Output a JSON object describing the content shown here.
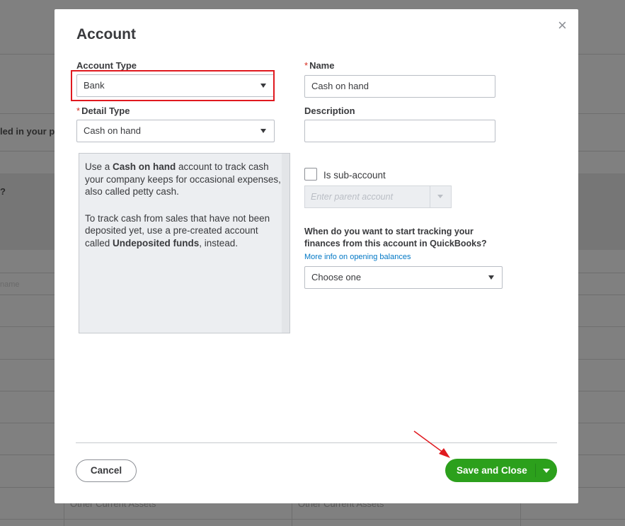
{
  "background": {
    "partial_text_1": "led in your p",
    "partial_text_2": "?",
    "partial_placeholder": "name",
    "row_cell_1": "Other Current Assets",
    "row_cell_2": "Other Current Assets"
  },
  "dialog": {
    "title": "Account",
    "close_glyph": "×",
    "account_type": {
      "label": "Account Type",
      "value": "Bank"
    },
    "detail_type": {
      "label": "Detail Type",
      "required_mark": "*",
      "value": "Cash on hand"
    },
    "name": {
      "label": "Name",
      "required_mark": "*",
      "value": "Cash on hand"
    },
    "description": {
      "label": "Description",
      "value": ""
    },
    "info": {
      "p1_pre": "Use a ",
      "p1_bold": "Cash on hand",
      "p1_post": " account to track cash your company keeps for occasional expenses, also called petty cash.",
      "p2_pre": "To track cash from sales that have not been deposited yet, use a pre-created account called ",
      "p2_bold": "Undeposited funds",
      "p2_post": ", instead."
    },
    "sub_account": {
      "label": "Is sub-account",
      "checked": false,
      "placeholder": "Enter parent account"
    },
    "opening_balance": {
      "question": "When do you want to start tracking your finances from this account in QuickBooks?",
      "link": "More info on opening balances",
      "select_value": "Choose one"
    },
    "footer": {
      "cancel_label": "Cancel",
      "save_label": "Save and Close"
    }
  },
  "colors": {
    "primary_green": "#2ca01c",
    "highlight_red": "#e0191f",
    "link_blue": "#0077c5",
    "required_red": "#d52b1e"
  }
}
